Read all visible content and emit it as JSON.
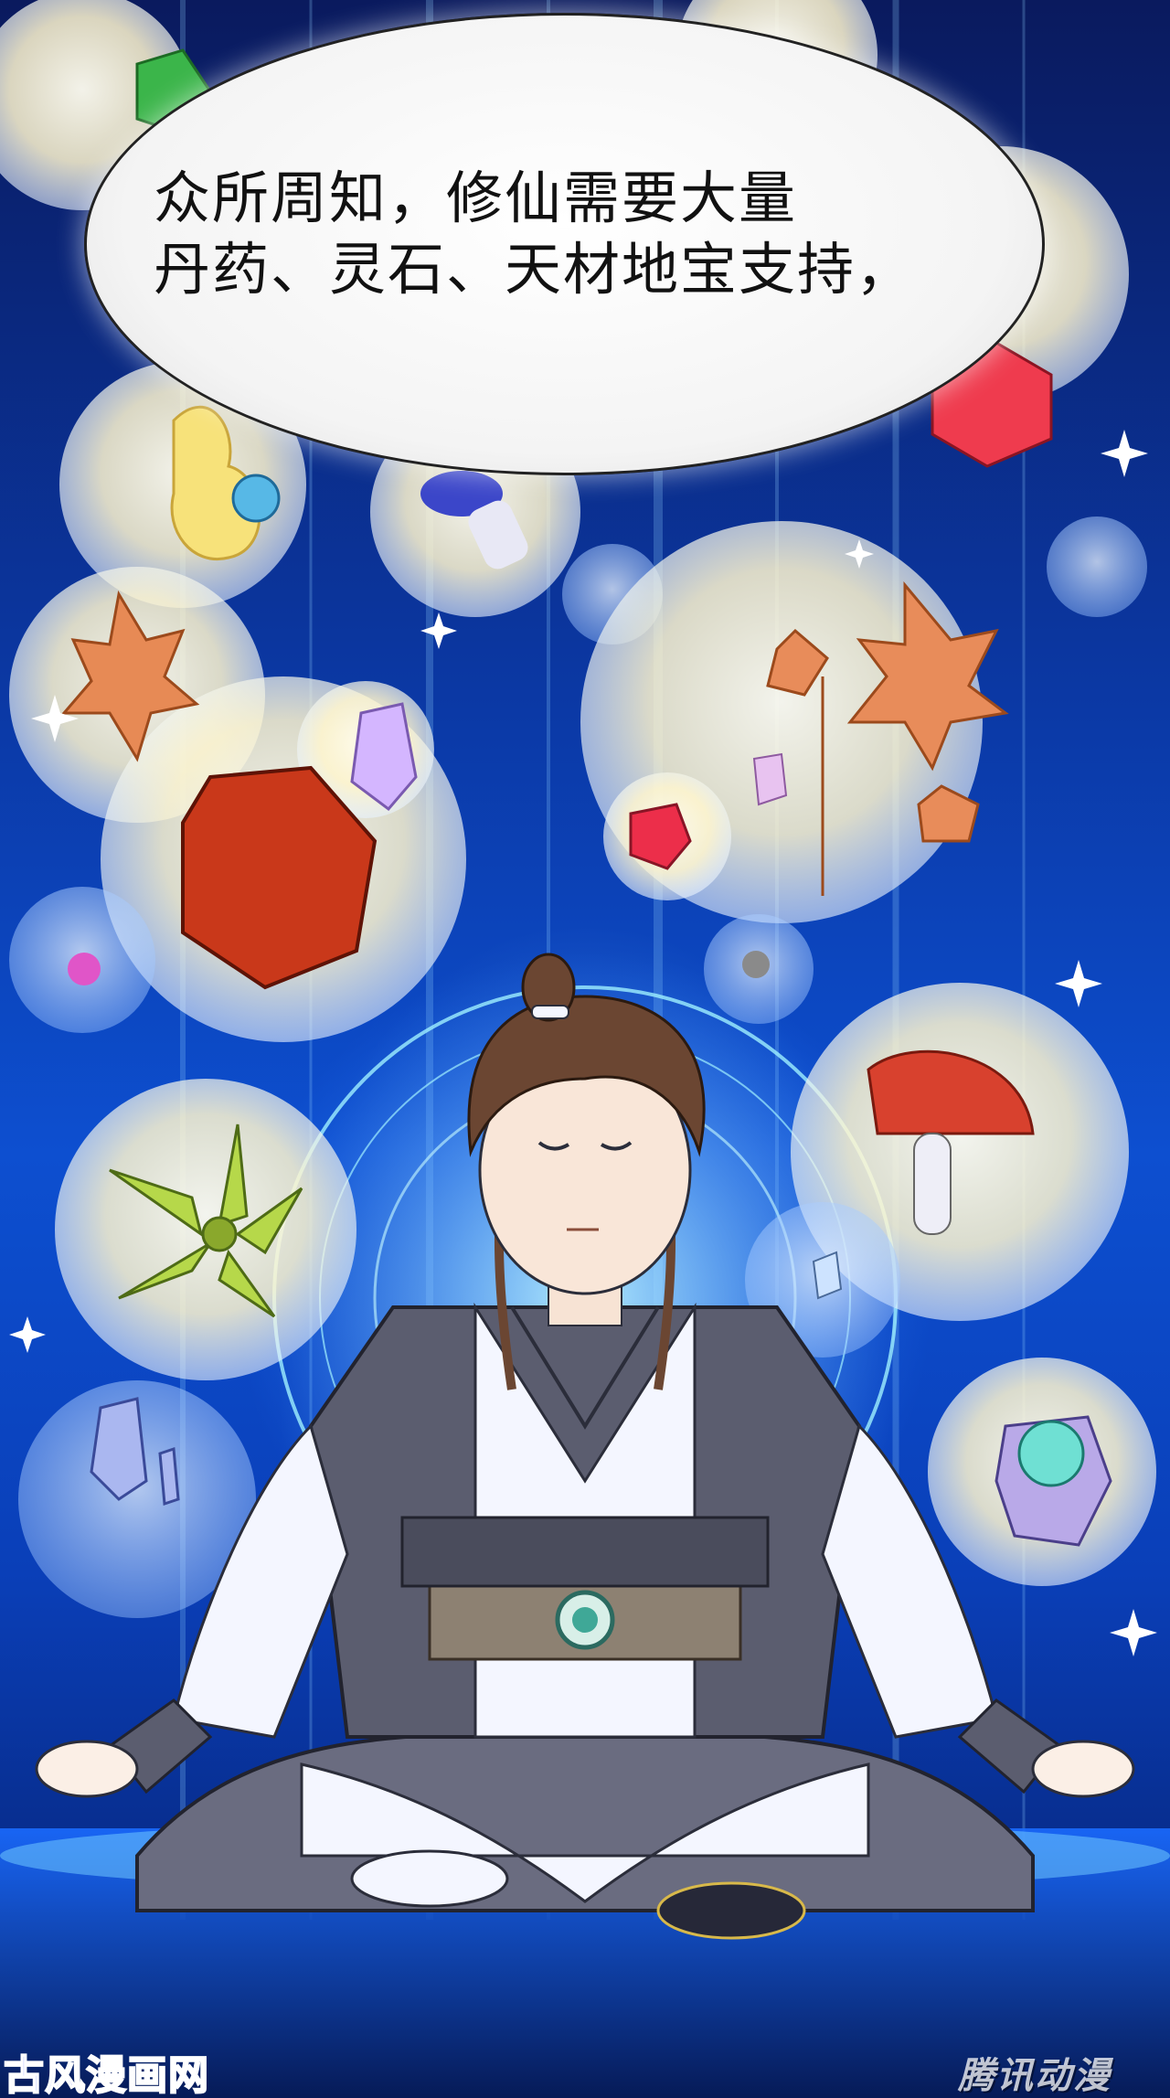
{
  "panel": {
    "speech_bubble": {
      "line1": "众所周知，修仙需要大量",
      "line2": "丹药、灵石、天材地宝支持，"
    },
    "watermarks": {
      "left": "古风漫画网",
      "right": "腾讯动漫"
    }
  },
  "palette": {
    "background_deep": "#0a1a5e",
    "background_glow": "#0d4fd0",
    "bubble": "#fffbe6",
    "robe_white": "#f4f6ff",
    "robe_grey": "#5b5d6f",
    "hair": "#6b4632"
  },
  "icons": [
    "emerald-gem-icon",
    "flame-pill-icon",
    "mushroom-icon",
    "red-gem-icon",
    "maple-leaf-icon",
    "amber-gem-icon",
    "crystal-icon",
    "maple-branch-icon",
    "red-mushroom-icon",
    "green-herb-icon",
    "blue-crystal-icon",
    "jade-stone-icon"
  ]
}
